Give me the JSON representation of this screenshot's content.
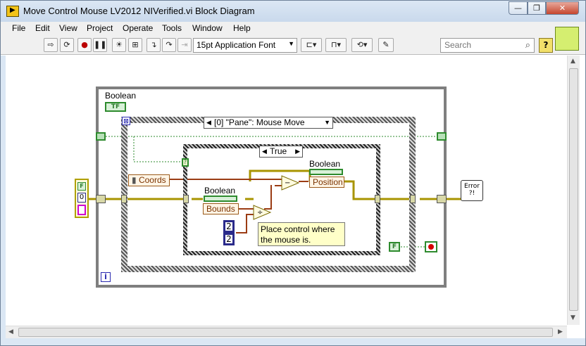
{
  "window": {
    "title": "Move Control Mouse LV2012 NIVerified.vi Block Diagram",
    "min_label": "—",
    "max_label": "❐",
    "close_label": "✕"
  },
  "menu": [
    "File",
    "Edit",
    "View",
    "Project",
    "Operate",
    "Tools",
    "Window",
    "Help"
  ],
  "toolbar": {
    "font": "15pt Application Font",
    "search_placeholder": "Search",
    "help_label": "?"
  },
  "diagram": {
    "loop_label": "Boolean",
    "loop_const": "TF",
    "event_selector": "[0] \"Pane\": Mouse Move",
    "case_selector": "True",
    "coords_label": "Coords",
    "bounds_heading": "Boolean",
    "bounds_label": "Bounds",
    "position_heading": "Boolean",
    "position_label": "Position",
    "const_a": "2",
    "const_b": "2",
    "comment": "Place control where the mouse is.",
    "cluster_f": "F",
    "cluster_zero": "0",
    "stop_const": "F",
    "error_label": "Error ?!",
    "info_i": "i",
    "timeout_label": "?"
  }
}
